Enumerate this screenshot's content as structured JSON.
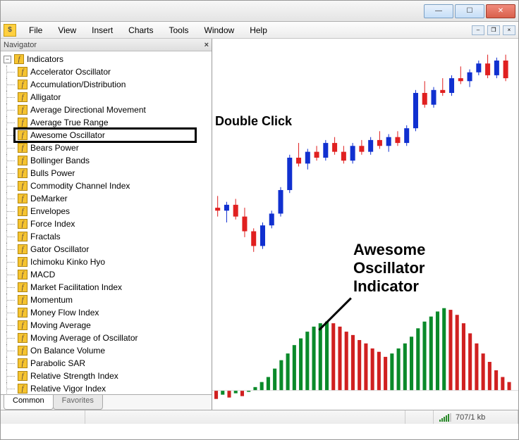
{
  "menubar": {
    "items": [
      "File",
      "View",
      "Insert",
      "Charts",
      "Tools",
      "Window",
      "Help"
    ]
  },
  "navigator": {
    "title": "Navigator",
    "root_label": "Indicators",
    "items": [
      "Accelerator Oscillator",
      "Accumulation/Distribution",
      "Alligator",
      "Average Directional Movement",
      "Average True Range",
      "Awesome Oscillator",
      "Bears Power",
      "Bollinger Bands",
      "Bulls Power",
      "Commodity Channel Index",
      "DeMarker",
      "Envelopes",
      "Force Index",
      "Fractals",
      "Gator Oscillator",
      "Ichimoku Kinko Hyo",
      "MACD",
      "Market Facilitation Index",
      "Momentum",
      "Money Flow Index",
      "Moving Average",
      "Moving Average of Oscillator",
      "On Balance Volume",
      "Parabolic SAR",
      "Relative Strength Index",
      "Relative Vigor Index"
    ],
    "highlighted": "Awesome Oscillator",
    "tabs": {
      "active": "Common",
      "inactive": "Favorites"
    }
  },
  "annotations": {
    "double_click": "Double Click",
    "indicator_name_l1": "Awesome",
    "indicator_name_l2": "Oscillator",
    "indicator_name_l3": "Indicator"
  },
  "statusbar": {
    "traffic": "707/1 kb"
  },
  "chart_data": {
    "type": "candlestick+histogram",
    "price": {
      "note": "Approximate OHLC candles, uptrend",
      "candles": [
        {
          "o": 100,
          "h": 104,
          "l": 97,
          "c": 99,
          "color": "red"
        },
        {
          "o": 99,
          "h": 102,
          "l": 95,
          "c": 101,
          "color": "blue"
        },
        {
          "o": 101,
          "h": 103,
          "l": 96,
          "c": 97,
          "color": "red"
        },
        {
          "o": 97,
          "h": 100,
          "l": 90,
          "c": 92,
          "color": "red"
        },
        {
          "o": 92,
          "h": 93,
          "l": 85,
          "c": 87,
          "color": "red"
        },
        {
          "o": 87,
          "h": 95,
          "l": 86,
          "c": 94,
          "color": "blue"
        },
        {
          "o": 94,
          "h": 99,
          "l": 93,
          "c": 98,
          "color": "blue"
        },
        {
          "o": 98,
          "h": 107,
          "l": 97,
          "c": 106,
          "color": "blue"
        },
        {
          "o": 106,
          "h": 118,
          "l": 105,
          "c": 117,
          "color": "blue"
        },
        {
          "o": 117,
          "h": 122,
          "l": 114,
          "c": 115,
          "color": "red"
        },
        {
          "o": 115,
          "h": 120,
          "l": 113,
          "c": 119,
          "color": "blue"
        },
        {
          "o": 119,
          "h": 121,
          "l": 116,
          "c": 117,
          "color": "red"
        },
        {
          "o": 117,
          "h": 123,
          "l": 116,
          "c": 122,
          "color": "blue"
        },
        {
          "o": 122,
          "h": 124,
          "l": 118,
          "c": 119,
          "color": "red"
        },
        {
          "o": 119,
          "h": 121,
          "l": 115,
          "c": 116,
          "color": "red"
        },
        {
          "o": 116,
          "h": 122,
          "l": 115,
          "c": 121,
          "color": "blue"
        },
        {
          "o": 121,
          "h": 123,
          "l": 118,
          "c": 119,
          "color": "red"
        },
        {
          "o": 119,
          "h": 124,
          "l": 118,
          "c": 123,
          "color": "blue"
        },
        {
          "o": 123,
          "h": 126,
          "l": 120,
          "c": 121,
          "color": "red"
        },
        {
          "o": 121,
          "h": 125,
          "l": 119,
          "c": 124,
          "color": "blue"
        },
        {
          "o": 124,
          "h": 126,
          "l": 121,
          "c": 122,
          "color": "red"
        },
        {
          "o": 122,
          "h": 128,
          "l": 121,
          "c": 127,
          "color": "blue"
        },
        {
          "o": 127,
          "h": 140,
          "l": 126,
          "c": 139,
          "color": "blue"
        },
        {
          "o": 139,
          "h": 143,
          "l": 134,
          "c": 135,
          "color": "red"
        },
        {
          "o": 135,
          "h": 141,
          "l": 134,
          "c": 140,
          "color": "blue"
        },
        {
          "o": 140,
          "h": 144,
          "l": 138,
          "c": 139,
          "color": "red"
        },
        {
          "o": 139,
          "h": 145,
          "l": 138,
          "c": 144,
          "color": "blue"
        },
        {
          "o": 144,
          "h": 148,
          "l": 142,
          "c": 143,
          "color": "red"
        },
        {
          "o": 143,
          "h": 147,
          "l": 141,
          "c": 146,
          "color": "blue"
        },
        {
          "o": 146,
          "h": 150,
          "l": 145,
          "c": 149,
          "color": "blue"
        },
        {
          "o": 149,
          "h": 152,
          "l": 144,
          "c": 145,
          "color": "red"
        },
        {
          "o": 145,
          "h": 151,
          "l": 144,
          "c": 150,
          "color": "blue"
        },
        {
          "o": 150,
          "h": 152,
          "l": 143,
          "c": 144,
          "color": "red"
        }
      ],
      "ylim": [
        85,
        155
      ]
    },
    "oscillator": {
      "note": "Awesome Oscillator histogram values around zero line",
      "values": [
        -6,
        -3,
        -5,
        -2,
        -4,
        -1,
        2,
        5,
        8,
        13,
        18,
        22,
        27,
        31,
        35,
        38,
        40,
        41,
        40,
        38,
        35,
        33,
        30,
        28,
        25,
        23,
        20,
        22,
        25,
        28,
        32,
        37,
        41,
        44,
        47,
        49,
        48,
        45,
        40,
        34,
        28,
        22,
        17,
        12,
        8,
        5
      ],
      "colors": [
        "r",
        "g",
        "r",
        "g",
        "r",
        "g",
        "g",
        "g",
        "g",
        "g",
        "g",
        "g",
        "g",
        "g",
        "g",
        "g",
        "g",
        "g",
        "r",
        "r",
        "r",
        "r",
        "r",
        "r",
        "r",
        "r",
        "r",
        "g",
        "g",
        "g",
        "g",
        "g",
        "g",
        "g",
        "g",
        "g",
        "r",
        "r",
        "r",
        "r",
        "r",
        "r",
        "r",
        "r",
        "r",
        "r"
      ],
      "ylim": [
        -10,
        55
      ]
    }
  }
}
